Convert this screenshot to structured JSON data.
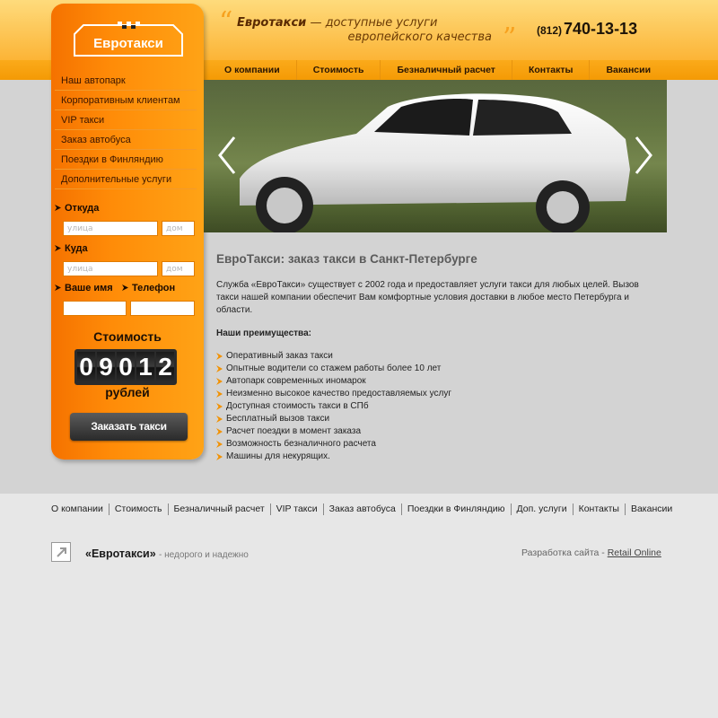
{
  "header": {
    "slogan_brand": "Евротакси",
    "slogan_line1": "— доступные услуги",
    "slogan_line2": "европейского качества",
    "phone_code": "(812)",
    "phone_number": "740-13-13"
  },
  "topnav": [
    "О компании",
    "Стоимость",
    "Безналичный расчет",
    "Контакты",
    "Вакансии"
  ],
  "sidebar": {
    "logo": "Евротакси",
    "menu": [
      "Наш автопарк",
      "Корпоративным клиентам",
      "VIP такси",
      "Заказ автобуса",
      "Поездки в Финляндию",
      "Дополнительные услуги"
    ],
    "from_label": "Откуда",
    "to_label": "Куда",
    "street_placeholder": "улица",
    "house_placeholder": "дом",
    "name_label": "Ваше имя",
    "phone_label": "Телефон",
    "cost_label": "Стоимость",
    "cost_digits": [
      "0",
      "9",
      "0",
      "1",
      "2"
    ],
    "currency": "рублей",
    "order_button": "Заказать такси"
  },
  "content": {
    "title": "ЕвроТакси: заказ такси в Санкт-Петербурге",
    "intro": "Служба «ЕвроТакси» существует с 2002 года и предоставляет услуги такси для любых целей. Вызов такси нашей компании обеспечит Вам комфортные условия доставки в любое место Петербурга и области.",
    "advantages_title": "Наши преимущества:",
    "advantages": [
      "Оперативный заказ такси",
      "Опытные водители со стажем работы более 10 лет",
      "Автопарк современных иномарок",
      "Неизменно высокое качество предоставляемых услуг",
      "Доступная стоимость такси в СПб",
      "Бесплатный вызов такси",
      "Расчет поездки в момент заказа",
      "Возможность безналичного расчета",
      "Машины для некурящих."
    ]
  },
  "footer": {
    "nav": [
      "О компании",
      "Стоимость",
      "Безналичный расчет",
      "VIP такси",
      "Заказ автобуса",
      "Поездки в Финляндию",
      "Доп. услуги",
      "Контакты",
      "Вакансии"
    ],
    "brand": "«Евротакси»",
    "tagline": "- недорого и надежно",
    "dev_label": "Разработка сайта -",
    "dev_link": "Retail Online"
  },
  "colors": {
    "accent": "#ff8c08",
    "nav": "#f49a05",
    "band": "#d3d3d3"
  },
  "icons": {
    "prev": "chevron-left-icon",
    "next": "chevron-right-icon",
    "bullet": "arrow-bullet-icon",
    "footer": "external-link-icon"
  }
}
